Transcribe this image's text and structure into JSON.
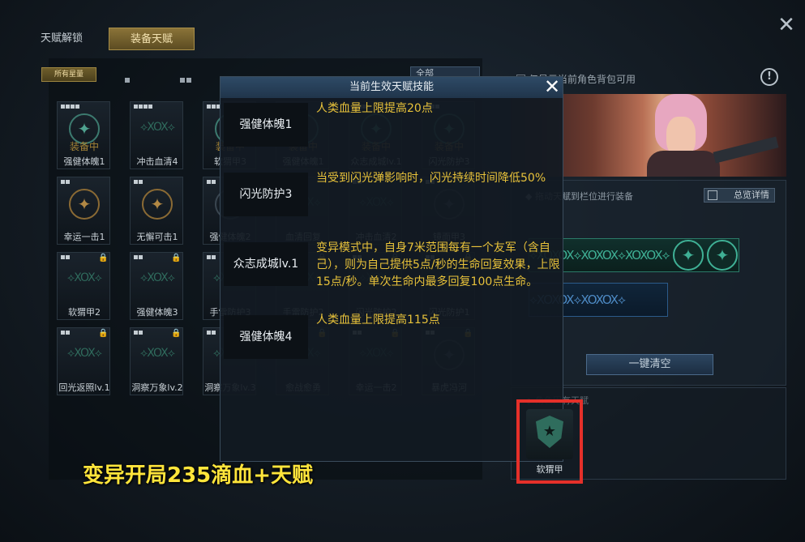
{
  "tabs": {
    "unlock": "天赋解锁",
    "equip": "装备天赋"
  },
  "filters": {
    "all": "所有星量"
  },
  "sort_select": "全部",
  "owned_filter": "仅显示当前角色背包可用",
  "cards": [
    {
      "name": "强健体魄1",
      "status": "装备中",
      "stars": 4,
      "icon": "emblem-teal",
      "locked": false
    },
    {
      "name": "冲击血清4",
      "status": "",
      "stars": 4,
      "icon": "dna-helix",
      "locked": false
    },
    {
      "name": "软猬甲3",
      "status": "装备中",
      "stars": 3,
      "icon": "emblem-teal",
      "locked": false
    },
    {
      "name": "强健体魄1",
      "status": "装备中",
      "stars": 3,
      "icon": "emblem-teal",
      "locked": false
    },
    {
      "name": "众志成城lv.1",
      "status": "装备中",
      "stars": 3,
      "icon": "emblem-teal",
      "locked": false
    },
    {
      "name": "闪光防护3",
      "status": "装备中",
      "stars": 3,
      "icon": "emblem-teal",
      "locked": false
    },
    {
      "name": "幸运一击1",
      "status": "",
      "stars": 2,
      "icon": "emblem-gold",
      "locked": false
    },
    {
      "name": "无懈可击1",
      "status": "",
      "stars": 2,
      "icon": "emblem-gold",
      "locked": false
    },
    {
      "name": "强健体魄2",
      "status": "",
      "stars": 2,
      "icon": "emblem-dim",
      "locked": false
    },
    {
      "name": "血清回复",
      "status": "",
      "stars": 2,
      "icon": "dna-helix",
      "locked": false
    },
    {
      "name": "冲击血清2",
      "status": "",
      "stars": 2,
      "icon": "dna-helix",
      "locked": false
    },
    {
      "name": "镜面甲3",
      "status": "",
      "stars": 2,
      "icon": "emblem-dim",
      "locked": false
    },
    {
      "name": "软猬甲2",
      "status": "",
      "stars": 2,
      "icon": "dna-helix",
      "locked": true
    },
    {
      "name": "强健体魄3",
      "status": "",
      "stars": 2,
      "icon": "dna-helix",
      "locked": true
    },
    {
      "name": "手雷防护3",
      "status": "",
      "stars": 2,
      "icon": "dna-helix",
      "locked": true
    },
    {
      "name": "手雷防护2",
      "status": "",
      "stars": 2,
      "icon": "dna-helix",
      "locked": true
    },
    {
      "name": "闪光防护2",
      "status": "",
      "stars": 2,
      "icon": "dna-helix",
      "locked": true
    },
    {
      "name": "闪光防护1",
      "status": "",
      "stars": 2,
      "icon": "dna-helix",
      "locked": true
    },
    {
      "name": "回光返照lv.1",
      "status": "",
      "stars": 2,
      "icon": "dna-helix",
      "locked": true
    },
    {
      "name": "洞察万象lv.2",
      "status": "",
      "stars": 2,
      "icon": "dna-helix",
      "locked": true
    },
    {
      "name": "洞察万象lv.3",
      "status": "",
      "stars": 2,
      "icon": "dna-helix",
      "locked": true
    },
    {
      "name": "愈战愈勇",
      "status": "",
      "stars": 2,
      "icon": "dna-helix",
      "locked": true
    },
    {
      "name": "幸运一击2",
      "status": "",
      "stars": 2,
      "icon": "dna-helix",
      "locked": true
    },
    {
      "name": "暴虎冯河",
      "status": "",
      "stars": 2,
      "icon": "emblem-dim",
      "locked": true
    }
  ],
  "right": {
    "slot_hint": "◆ 拖动天赋到栏位进行装备",
    "overview": "总览详情",
    "clear": "一键清空",
    "bottom_hint": "◆ 角色固有天赋",
    "highlight_label": "软猬甲"
  },
  "popup": {
    "title": "当前生效天赋技能",
    "skills": [
      {
        "name": "强健体魄1",
        "desc": "人类血量上限提高20点"
      },
      {
        "name": "闪光防护3",
        "desc": "当受到闪光弹影响时，闪光持续时间降低50%"
      },
      {
        "name": "众志成城lv.1",
        "desc": "变异模式中，自身7米范围每有一个友军（含自己），则为自己提供5点/秒的生命回复效果，上限15点/秒。单次生命内最多回复100点生命。"
      },
      {
        "name": "强健体魄4",
        "desc": "人类血量上限提高115点"
      }
    ]
  },
  "caption": "变异开局235滴血+天赋",
  "colors": {
    "accent_gold": "#8a7338",
    "desc_yellow": "#e8c23a",
    "highlight_red": "#e5302a",
    "caption_yellow": "#ffe53b"
  }
}
